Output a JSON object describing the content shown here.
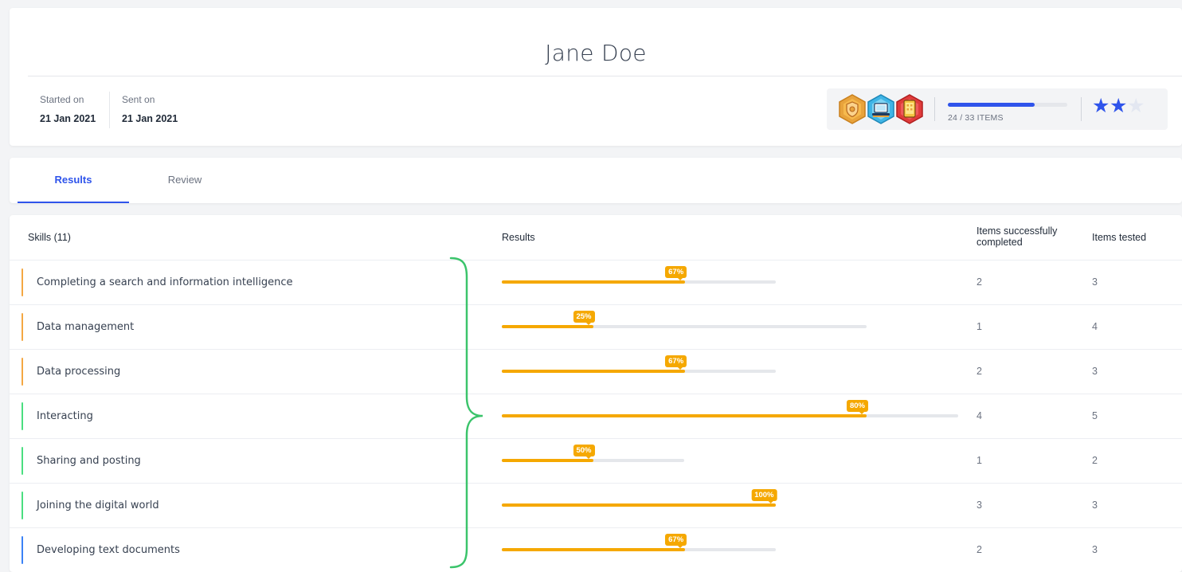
{
  "header": {
    "name": "Jane Doe",
    "started_label": "Started on",
    "started_value": "21 Jan 2021",
    "sent_label": "Sent on",
    "sent_value": "21 Jan 2021"
  },
  "summary": {
    "badges": [
      "shield-badge-icon",
      "laptop-badge-icon",
      "tablet-badge-icon"
    ],
    "items_completed": 24,
    "items_total": 33,
    "items_label": "24 / 33 ITEMS",
    "stars_filled": 2,
    "stars_total": 3
  },
  "tabs": [
    {
      "label": "Results",
      "active": true
    },
    {
      "label": "Review",
      "active": false
    }
  ],
  "table": {
    "headers": {
      "skills": "Skills (11)",
      "results": "Results",
      "completed": "Items successfully completed",
      "tested": "Items tested"
    },
    "rows": [
      {
        "skill": "Completing a search and information intelligence",
        "percent_label": "67%",
        "completed": "2",
        "tested": "3",
        "accent": "#f4a742",
        "percent": 67
      },
      {
        "skill": "Data management",
        "percent_label": "25%",
        "completed": "1",
        "tested": "4",
        "accent": "#f4a742",
        "percent": 25
      },
      {
        "skill": "Data processing",
        "percent_label": "67%",
        "completed": "2",
        "tested": "3",
        "accent": "#f4a742",
        "percent": 67
      },
      {
        "skill": "Interacting",
        "percent_label": "80%",
        "completed": "4",
        "tested": "5",
        "accent": "#4ade80",
        "percent": 80
      },
      {
        "skill": "Sharing and posting",
        "percent_label": "50%",
        "completed": "1",
        "tested": "2",
        "accent": "#4ade80",
        "percent": 50
      },
      {
        "skill": "Joining the digital world",
        "percent_label": "100%",
        "completed": "3",
        "tested": "3",
        "accent": "#4ade80",
        "percent": 100
      },
      {
        "skill": "Developing text documents",
        "percent_label": "67%",
        "completed": "2",
        "tested": "3",
        "accent": "#3b82f6",
        "percent": 67
      }
    ]
  },
  "colors": {
    "accent_blue": "#2f54eb",
    "bar_orange": "#f5a800",
    "brace_green": "#3bc46b"
  }
}
